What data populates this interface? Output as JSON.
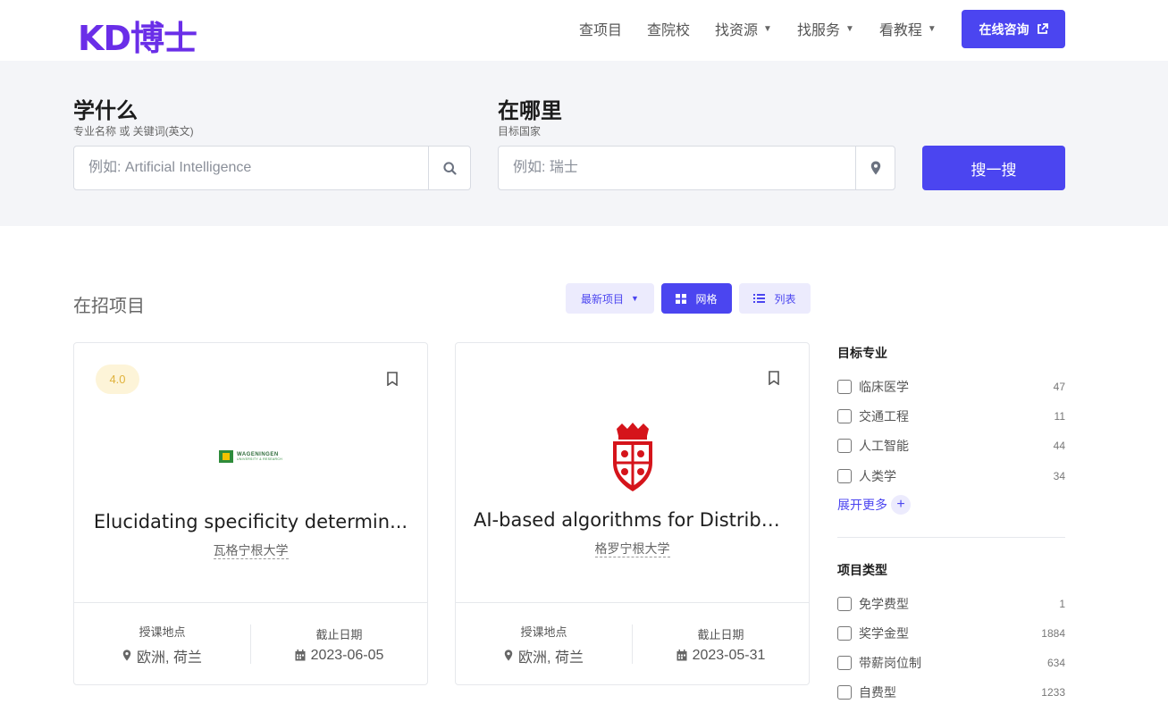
{
  "header": {
    "logo": "KD博士",
    "nav": [
      {
        "label": "查项目",
        "has_dropdown": false
      },
      {
        "label": "查院校",
        "has_dropdown": false
      },
      {
        "label": "找资源",
        "has_dropdown": true
      },
      {
        "label": "找服务",
        "has_dropdown": true
      },
      {
        "label": "看教程",
        "has_dropdown": true
      }
    ],
    "consult_label": "在线咨询"
  },
  "search": {
    "what_title": "学什么",
    "what_sub": "专业名称 或 关键词(英文)",
    "what_placeholder": "例如: Artificial Intelligence",
    "where_title": "在哪里",
    "where_sub": "目标国家",
    "where_placeholder": "例如: 瑞士",
    "button_label": "搜一搜"
  },
  "listing": {
    "section_title": "在招项目",
    "sort_label": "最新项目",
    "view_grid_label": "网格",
    "view_list_label": "列表"
  },
  "cards": [
    {
      "rating": "4.0",
      "logo_text": "WAGENINGEN",
      "logo_sub": "UNIVERSITY & RESEARCH",
      "title": "Elucidating specificity determin...",
      "university": "瓦格宁根大学",
      "location_label": "授课地点",
      "location": "欧洲, 荷兰",
      "deadline_label": "截止日期",
      "deadline": "2023-06-05"
    },
    {
      "rating": "",
      "title": "AI-based algorithms for Distribu...",
      "university": "格罗宁根大学",
      "location_label": "授课地点",
      "location": "欧洲, 荷兰",
      "deadline_label": "截止日期",
      "deadline": "2023-05-31"
    }
  ],
  "sidebar": {
    "majors_heading": "目标专业",
    "majors": [
      {
        "label": "临床医学",
        "count": "47"
      },
      {
        "label": "交通工程",
        "count": "11"
      },
      {
        "label": "人工智能",
        "count": "44"
      },
      {
        "label": "人类学",
        "count": "34"
      }
    ],
    "expand_label": "展开更多",
    "types_heading": "项目类型",
    "types": [
      {
        "label": "免学费型",
        "count": "1"
      },
      {
        "label": "奖学金型",
        "count": "1884"
      },
      {
        "label": "带薪岗位制",
        "count": "634"
      },
      {
        "label": "自费型",
        "count": "1233"
      }
    ]
  },
  "colors": {
    "accent": "#4b45f0",
    "logo": "#6a2ee8",
    "rating_bg": "#fdf4d8",
    "rating_text": "#e0b23c",
    "groningen_red": "#d5141b",
    "wageningen_green": "#2e8b3a"
  },
  "icons": [
    "external-link-icon",
    "search-icon",
    "map-pin-icon",
    "grid-icon",
    "list-icon",
    "bookmark-icon",
    "calendar-icon",
    "chevron-down-icon",
    "plus-icon"
  ]
}
